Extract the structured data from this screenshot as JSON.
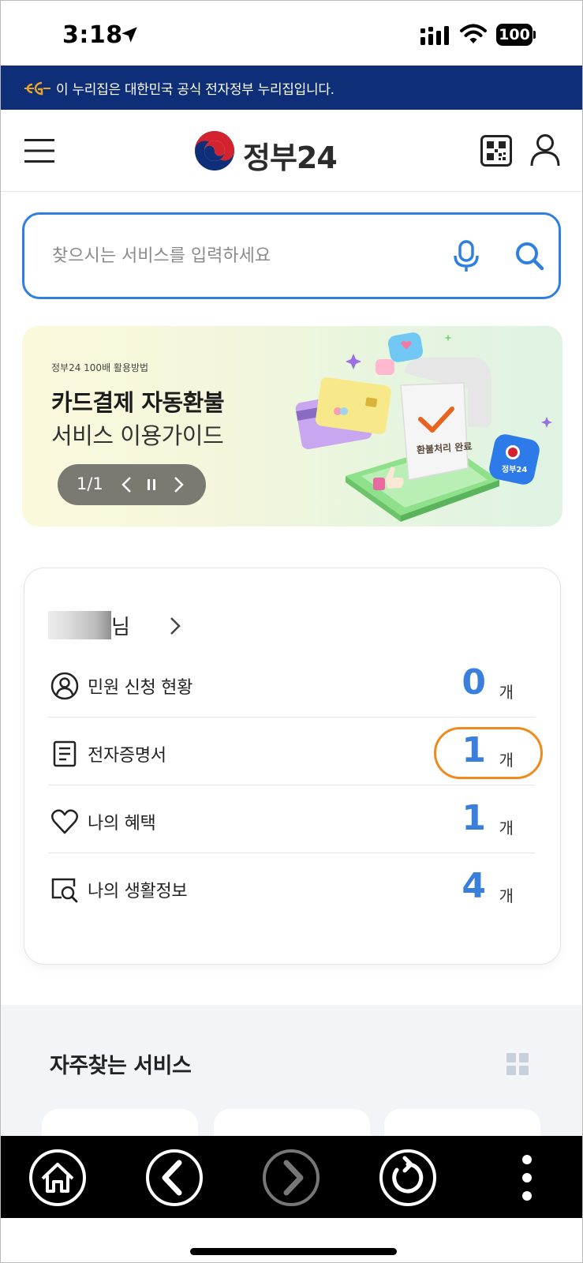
{
  "status_bar": {
    "time": "3:18",
    "battery": "100"
  },
  "gov_banner": {
    "text": "이 누리집은 대한민국 공식 전자정부 누리집입니다."
  },
  "header": {
    "logo_text": "정부24"
  },
  "search": {
    "placeholder": "찾으시는 서비스를 입력하세요"
  },
  "promo": {
    "subtitle": "정부24 100배 활용방법",
    "title_line1": "카드결제 자동환불",
    "title_line2": "서비스 이용가이드",
    "counter": "1/1",
    "receipt_label": "환불처리 완료",
    "app_label": "정부24"
  },
  "my_card": {
    "name_suffix": "님",
    "rows": [
      {
        "label": "민원 신청 현황",
        "value": "0",
        "unit": "개",
        "icon": "user-circle-icon"
      },
      {
        "label": "전자증명서",
        "value": "1",
        "unit": "개",
        "icon": "document-icon"
      },
      {
        "label": "나의 혜택",
        "value": "1",
        "unit": "개",
        "icon": "heart-icon"
      },
      {
        "label": "나의 생활정보",
        "value": "4",
        "unit": "개",
        "icon": "search-info-icon"
      }
    ]
  },
  "frequent": {
    "title": "자주찾는 서비스"
  },
  "colors": {
    "accent": "#2f7fe0",
    "banner_bg": "#0f2e78",
    "value_blue": "#3a7fdc",
    "highlight": "#ef8a1e"
  }
}
